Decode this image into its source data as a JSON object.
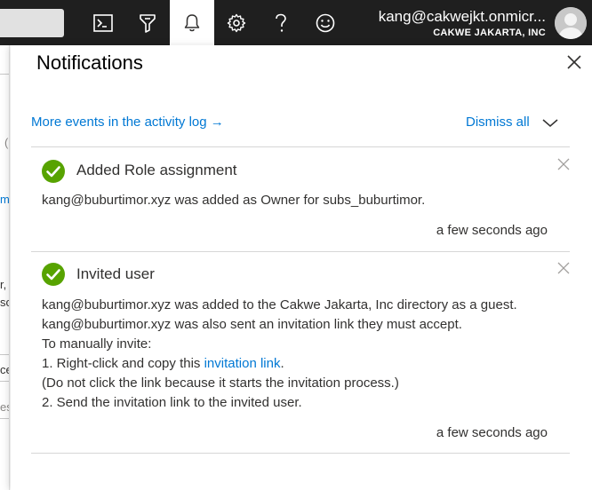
{
  "topbar": {
    "icons": [
      "cloud-shell-icon",
      "directory-filter-icon",
      "bell-icon",
      "gear-icon",
      "help-icon",
      "feedback-smiley-icon"
    ],
    "account_name": "kang@cakwejkt.onmicr...",
    "account_org": "CAKWE JAKARTA, INC"
  },
  "background": {
    "fragments": [
      "(",
      "m",
      "r,",
      "so",
      "ce",
      "es"
    ]
  },
  "panel": {
    "title": "Notifications",
    "activity_link": "More events in the activity log →",
    "dismiss_all": "Dismiss all",
    "notifications": [
      {
        "status": "success",
        "title": "Added Role assignment",
        "message_lines": [
          "kang@buburtimor.xyz was added as Owner for subs_buburtimor."
        ],
        "time": "a few seconds ago"
      },
      {
        "status": "success",
        "title": "Invited user",
        "message_lines": [
          "kang@buburtimor.xyz was added to the Cakwe Jakarta, Inc directory as a guest.",
          "kang@buburtimor.xyz was also sent an invitation link they must accept.",
          "To manually invite:",
          "1. Right-click and copy this ",
          "(Do not click the link because it starts the invitation process.)",
          "2. Send the invitation link to the invited user."
        ],
        "link_text": "invitation link",
        "link_suffix": ".",
        "time": "a few seconds ago"
      }
    ]
  },
  "colors": {
    "topbar_bg": "#1f1f1f",
    "link": "#0078d4",
    "success": "#57a300"
  }
}
